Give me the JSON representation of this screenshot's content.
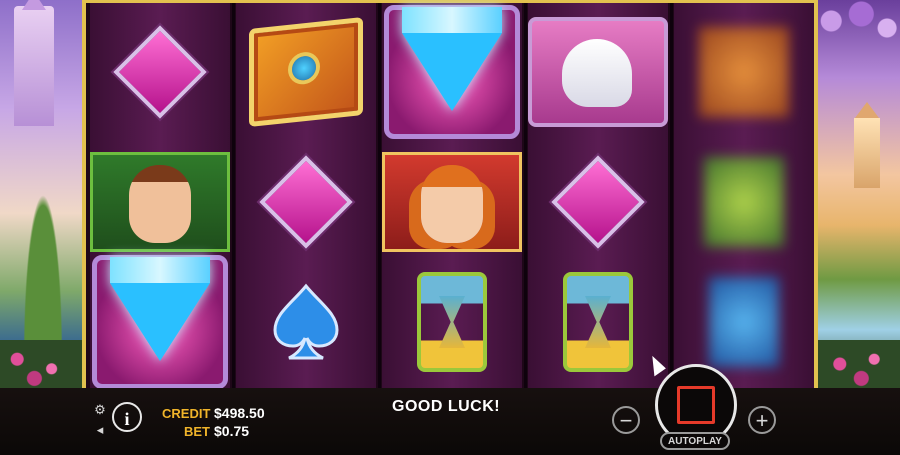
{
  "reels": [
    [
      "pink-diamond",
      "prince-portrait",
      "big-diamond"
    ],
    [
      "magic-book",
      "pink-diamond",
      "blue-spade"
    ],
    [
      "big-diamond",
      "princess-portrait",
      "hourglass"
    ],
    [
      "unicorn",
      "pink-diamond",
      "hourglass"
    ],
    [
      "spinning-blur",
      "spinning-blur",
      "spinning-blur"
    ]
  ],
  "status": {
    "credit_label": "CREDIT",
    "credit_value": "$498.50",
    "bet_label": "BET",
    "bet_value": "$0.75",
    "message": "GOOD LUCK!"
  },
  "controls": {
    "info": "i",
    "minus": "−",
    "plus": "+",
    "autoplay": "AUTOPLAY"
  },
  "colors": {
    "frame_gold": "#e2c24f",
    "reel_bg": "#5a1c52",
    "label_gold": "#f0b42a",
    "spin_stop": "#e53a2a"
  },
  "icons": {
    "settings": "gear-icon",
    "sound": "speaker-icon",
    "info": "info-icon",
    "spin": "stop-square-icon"
  }
}
